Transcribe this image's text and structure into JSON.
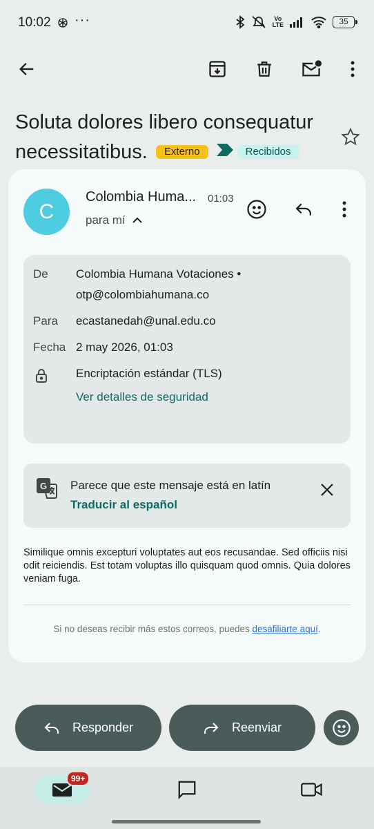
{
  "status_bar": {
    "time": "10:02",
    "dots": "···",
    "volte": "Vo\nLTE",
    "battery": "35"
  },
  "toolbar": {
    "back_icon": "arrow-back-icon",
    "archive_icon": "archive-icon",
    "delete_icon": "trash-icon",
    "unread_icon": "mark-unread-icon",
    "more_icon": "more-vert-icon"
  },
  "subject": {
    "text": "Soluta dolores libero consequatur necessitatibus.",
    "label_external": "Externo",
    "label_inbox": "Recibidos"
  },
  "message": {
    "avatar_letter": "C",
    "sender": "Colombia Huma...",
    "time": "01:03",
    "to_me": "para mí",
    "details": {
      "from_label": "De",
      "from_name": "Colombia Humana Votaciones •",
      "from_email": "otp@colombiahumana.co",
      "to_label": "Para",
      "to_value": "ecastanedah@unal.edu.co",
      "date_label": "Fecha",
      "date_value": "2 may 2026, 01:03",
      "encryption": "Encriptación estándar (TLS)",
      "security_link": "Ver detalles de seguridad"
    },
    "translate": {
      "notice": "Parece que este mensaje está en latín",
      "action": "Traducir al español"
    },
    "body": "Similique omnis excepturi voluptates aut eos recusandae. Sed officiis nisi odit reiciendis. Est totam voluptas illo quisquam quod omnis. Quia dolores veniam fuga.",
    "unsubscribe_prefix": "Si no deseas recibir más estos correos, puedes ",
    "unsubscribe_link": "desafiliarte aquí",
    "unsubscribe_suffix": "."
  },
  "actions": {
    "reply": "Responder",
    "forward": "Reenviar"
  },
  "bottom_nav": {
    "mail_badge": "99+"
  },
  "colors": {
    "accent": "#0b6b65",
    "action_button": "#4a5c59",
    "avatar": "#4fcde0",
    "label_external": "#f7c21a",
    "label_inbox": "#c8f2ee",
    "badge": "#c2271f"
  }
}
